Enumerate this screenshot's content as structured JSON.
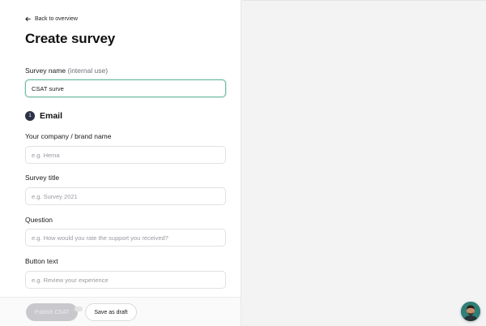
{
  "nav": {
    "back_label": "Back to overview"
  },
  "page": {
    "title": "Create survey"
  },
  "survey_name": {
    "label": "Survey name",
    "hint": "(internal use)",
    "value": "CSAT surve"
  },
  "email_section": {
    "step_number": "1",
    "title": "Email",
    "fields": {
      "brand": {
        "label": "Your company / brand name",
        "placeholder": "e.g. Hema"
      },
      "survey_title": {
        "label": "Survey title",
        "placeholder": "e.g. Survey 2021"
      },
      "question": {
        "label": "Question",
        "placeholder": "e.g. How would you rate the support you received?"
      },
      "button_text": {
        "label": "Button text",
        "placeholder": "e.g. Review your experience"
      }
    }
  },
  "footer": {
    "publish_label": "Publish CSAT",
    "draft_label": "Save as draft"
  },
  "icons": {
    "back": "arrow-left-icon",
    "support": "support-avatar"
  },
  "colors": {
    "accent_focus": "#6fb9a3",
    "step_badge": "#2d3347",
    "publish_disabled": "#c9c9cd",
    "avatar_bg": "#2f7f76"
  }
}
